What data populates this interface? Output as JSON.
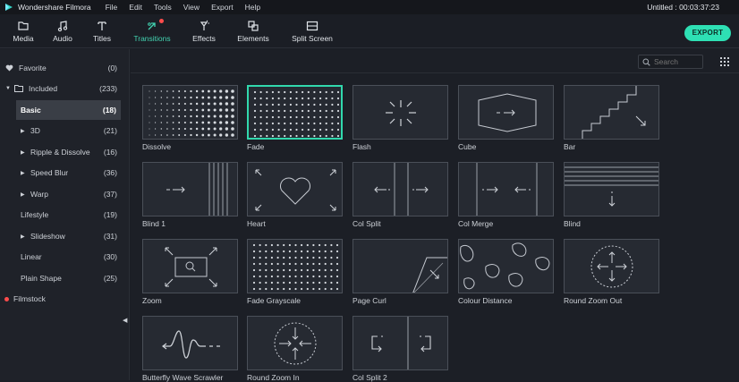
{
  "titlebar": {
    "app_name": "Wondershare Filmora",
    "menu": [
      "File",
      "Edit",
      "Tools",
      "View",
      "Export",
      "Help"
    ],
    "project_title": "Untitled : 00:03:37:23"
  },
  "toolbar": {
    "tools": [
      {
        "label": "Media",
        "icon": "folder-icon"
      },
      {
        "label": "Audio",
        "icon": "music-icon"
      },
      {
        "label": "Titles",
        "icon": "text-icon"
      },
      {
        "label": "Transitions",
        "icon": "transitions-icon",
        "active": true,
        "badge": true
      },
      {
        "label": "Effects",
        "icon": "effects-icon"
      },
      {
        "label": "Elements",
        "icon": "elements-icon"
      },
      {
        "label": "Split Screen",
        "icon": "split-screen-icon"
      }
    ],
    "export_label": "EXPORT",
    "accent": "#2ee0b4"
  },
  "sidebar": {
    "items": [
      {
        "label": "Favorite",
        "count": "(0)",
        "icon": "heart-icon"
      },
      {
        "label": "Included",
        "count": "(233)",
        "icon": "folder-icon",
        "expanded": true
      },
      {
        "label": "Basic",
        "count": "(18)",
        "selected": true
      },
      {
        "label": "3D",
        "count": "(21)",
        "collapsed_arrow": true
      },
      {
        "label": "Ripple & Dissolve",
        "count": "(16)",
        "collapsed_arrow": true
      },
      {
        "label": "Speed Blur",
        "count": "(36)",
        "collapsed_arrow": true
      },
      {
        "label": "Warp",
        "count": "(37)",
        "collapsed_arrow": true
      },
      {
        "label": "Lifestyle",
        "count": "(19)"
      },
      {
        "label": "Slideshow",
        "count": "(31)",
        "collapsed_arrow": true
      },
      {
        "label": "Linear",
        "count": "(30)"
      },
      {
        "label": "Plain Shape",
        "count": "(25)"
      },
      {
        "label": "Filmstock",
        "icon": "red-dot-icon"
      }
    ]
  },
  "search": {
    "placeholder": "Search"
  },
  "transitions": [
    {
      "name": "Dissolve",
      "thumb": "dissolve"
    },
    {
      "name": "Fade",
      "thumb": "fade",
      "selected": true
    },
    {
      "name": "Flash",
      "thumb": "flash"
    },
    {
      "name": "Cube",
      "thumb": "cube"
    },
    {
      "name": "Bar",
      "thumb": "bar"
    },
    {
      "name": "Blind 1",
      "thumb": "blind1"
    },
    {
      "name": "Heart",
      "thumb": "heart"
    },
    {
      "name": "Col Split",
      "thumb": "colsplit"
    },
    {
      "name": "Col Merge",
      "thumb": "colmerge"
    },
    {
      "name": "Blind",
      "thumb": "blind"
    },
    {
      "name": "Zoom",
      "thumb": "zoom"
    },
    {
      "name": "Fade Grayscale",
      "thumb": "fadegray"
    },
    {
      "name": "Page Curl",
      "thumb": "pagecurl"
    },
    {
      "name": "Colour Distance",
      "thumb": "colourdist"
    },
    {
      "name": "Round Zoom Out",
      "thumb": "roundzoomout"
    },
    {
      "name": "Butterfly Wave Scrawler",
      "thumb": "butterfly"
    },
    {
      "name": "Round Zoom In",
      "thumb": "roundzoomin"
    },
    {
      "name": "Col Split 2",
      "thumb": "colsplit2"
    }
  ]
}
